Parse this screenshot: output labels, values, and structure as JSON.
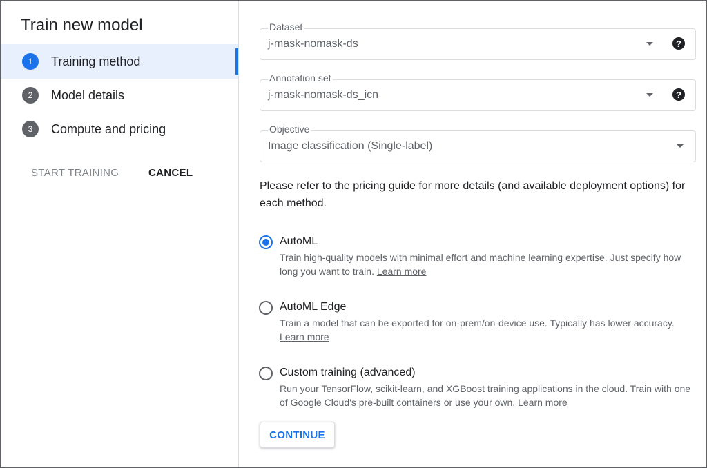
{
  "left_panel": {
    "title": "Train new model",
    "steps": [
      {
        "num": "1",
        "label": "Training method"
      },
      {
        "num": "2",
        "label": "Model details"
      },
      {
        "num": "3",
        "label": "Compute and pricing"
      }
    ],
    "start_training_label": "START TRAINING",
    "cancel_label": "CANCEL"
  },
  "form": {
    "dataset": {
      "label": "Dataset",
      "value": "j-mask-nomask-ds"
    },
    "annotation_set": {
      "label": "Annotation set",
      "value": "j-mask-nomask-ds_icn"
    },
    "objective": {
      "label": "Objective",
      "value": "Image classification (Single-label)"
    },
    "info_text": "Please refer to the pricing guide for more details (and available deployment options) for each method.",
    "options": [
      {
        "title": "AutoML",
        "description": "Train high-quality models with minimal effort and machine learning expertise. Just specify how long you want to train.",
        "link": "Learn more",
        "selected": true
      },
      {
        "title": "AutoML Edge",
        "description": "Train a model that can be exported for on-prem/on-device use. Typically has lower accuracy.",
        "link": "Learn more",
        "selected": false
      },
      {
        "title": "Custom training (advanced)",
        "description": "Run your TensorFlow, scikit-learn, and XGBoost training applications in the cloud. Train with one of Google Cloud's pre-built containers or use your own.",
        "link": "Learn more",
        "selected": false
      }
    ],
    "continue_label": "CONTINUE"
  },
  "icons": {
    "help": "help-icon",
    "dropdown": "dropdown-arrow-icon"
  },
  "colors": {
    "accent": "#1a73e8",
    "active_step_bg": "#e8f0fe"
  }
}
